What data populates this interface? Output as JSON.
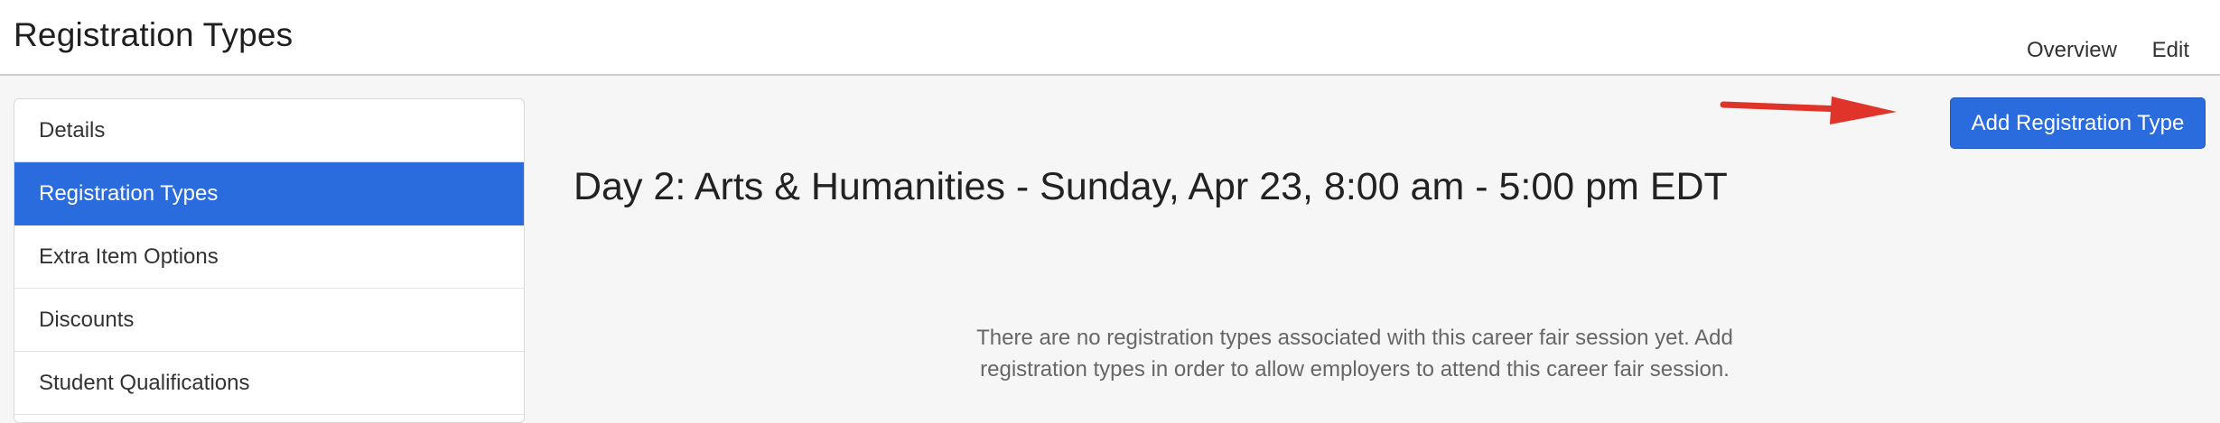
{
  "header": {
    "title": "Registration Types",
    "nav": {
      "overview": "Overview",
      "edit": "Edit"
    }
  },
  "sidebar": {
    "items": [
      {
        "label": "Details",
        "active": false
      },
      {
        "label": "Registration Types",
        "active": true
      },
      {
        "label": "Extra Item Options",
        "active": false
      },
      {
        "label": "Discounts",
        "active": false
      },
      {
        "label": "Student Qualifications",
        "active": false
      }
    ]
  },
  "main": {
    "add_button_label": "Add Registration Type",
    "session_heading": "Day 2: Arts & Humanities - Sunday, Apr 23, 8:00 am - 5:00 pm EDT",
    "empty_message": "There are no registration types associated with this career fair session yet. Add registration types in order to allow employers to attend this career fair session."
  },
  "colors": {
    "accent": "#2a6bdd",
    "annotation_arrow": "#e0332a",
    "background": "#f6f6f6"
  },
  "icons": {
    "annotation": "red-arrow-icon"
  }
}
